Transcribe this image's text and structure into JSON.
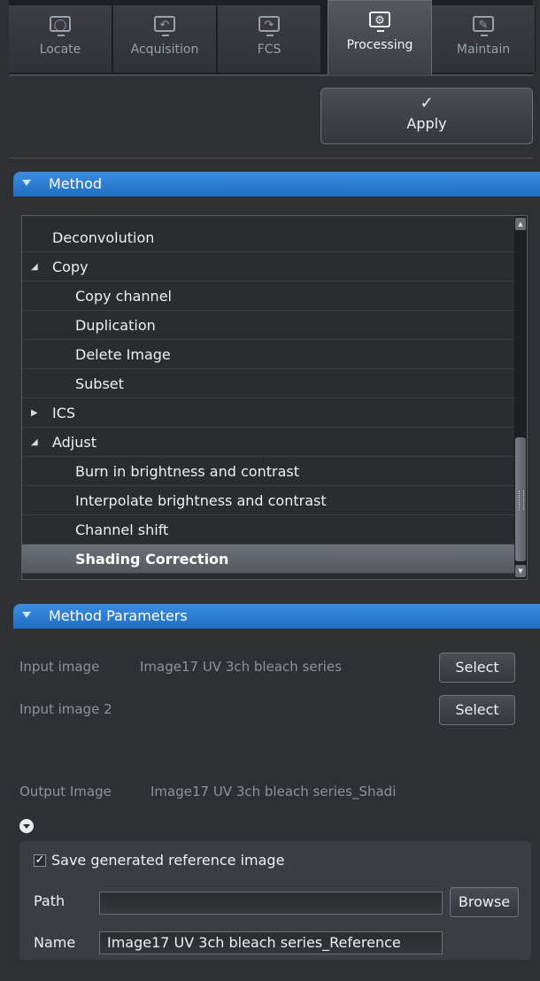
{
  "tabs": [
    {
      "label": "Locate",
      "icon": "locate-icon"
    },
    {
      "label": "Acquisition",
      "icon": "acquisition-icon"
    },
    {
      "label": "FCS",
      "icon": "fcs-icon"
    },
    {
      "label": "Processing",
      "icon": "processing-gear-icon",
      "active": true
    },
    {
      "label": "Maintain",
      "icon": "maintain-icon"
    }
  ],
  "apply": {
    "label": "Apply",
    "icon": "checkmark-icon"
  },
  "method_section": {
    "title": "Method"
  },
  "method_list": {
    "items": [
      {
        "label": "Deconvolution",
        "level": 0,
        "expander": ""
      },
      {
        "label": "Copy",
        "level": 0,
        "expander": "expanded"
      },
      {
        "label": "Copy channel",
        "level": 1
      },
      {
        "label": "Duplication",
        "level": 1
      },
      {
        "label": "Delete Image",
        "level": 1
      },
      {
        "label": "Subset",
        "level": 1
      },
      {
        "label": "ICS",
        "level": 0,
        "expander": "collapsed"
      },
      {
        "label": "Adjust",
        "level": 0,
        "expander": "expanded"
      },
      {
        "label": "Burn in brightness and contrast",
        "level": 1
      },
      {
        "label": "Interpolate brightness and contrast",
        "level": 1
      },
      {
        "label": "Channel shift",
        "level": 1
      },
      {
        "label": "Shading Correction",
        "level": 1,
        "selected": true
      }
    ]
  },
  "params_section": {
    "title": "Method Parameters"
  },
  "params": {
    "input_image_label": "Input image",
    "input_image_value": "Image17 UV 3ch bleach series",
    "input_image2_label": "Input image 2",
    "select_label": "Select",
    "output_image_label": "Output Image",
    "output_image_value": "Image17 UV 3ch bleach series_Shadi"
  },
  "reference": {
    "save_checked": true,
    "save_label": "Save generated reference image",
    "path_label": "Path",
    "path_value": "",
    "browse_label": "Browse",
    "name_label": "Name",
    "name_value": "Image17 UV 3ch bleach series_Reference"
  },
  "colors": {
    "accent": "#2f7fd6",
    "background": "#2e3033",
    "selected_row": "#62666b"
  }
}
